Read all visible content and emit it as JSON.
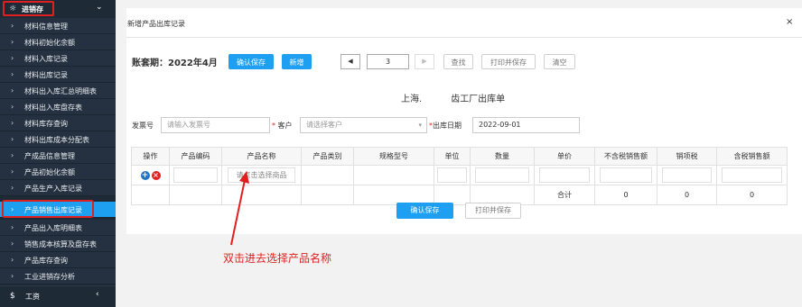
{
  "sidebar": {
    "section_icon": "☼",
    "section_label": "进销存",
    "section_chevron": "⌄",
    "items": [
      {
        "label": "材料信息管理"
      },
      {
        "label": "材料初始化余额"
      },
      {
        "label": "材料入库记录"
      },
      {
        "label": "材料出库记录"
      },
      {
        "label": "材料出入库汇总明细表"
      },
      {
        "label": "材料出入库盘存表"
      },
      {
        "label": "材料库存查询"
      },
      {
        "label": "材料出库成本分配表"
      },
      {
        "label": "产成品信息管理"
      },
      {
        "label": "产品初始化余额"
      },
      {
        "label": "产品生产入库记录"
      },
      {
        "label": "产品销售出库记录"
      },
      {
        "label": "产品出入库明细表"
      },
      {
        "label": "销售成本核算及盘存表"
      },
      {
        "label": "产品库存查询"
      },
      {
        "label": "工业进销存分析"
      }
    ],
    "footer_icon": "$",
    "footer_label": "工资",
    "footer_chevron": "‹",
    "item_arrow": "›",
    "active_color": "#1ea0f0",
    "highlight_color": "#e02020"
  },
  "modal": {
    "title": "新增产品出库记录",
    "close": "×",
    "period": "账套期：2022年4月",
    "buttons": {
      "confirm_save": "确认保存",
      "add_new": "新增",
      "find": "查找",
      "print_save": "打印并保存",
      "clear": "清空"
    },
    "pager": {
      "prev": "◀",
      "page": "3",
      "next": "▶"
    },
    "form_title_a": "上海.",
    "form_title_b": "齿工厂出库单",
    "fields": {
      "invoice_label": "发票号",
      "invoice_placeholder": "请输入发票号",
      "customer_label": "客户",
      "customer_placeholder": "请选择客户",
      "customer_dd": "▾",
      "date_label": "出库日期",
      "date_value": "2022-09-01",
      "required_mark": "*"
    },
    "table": {
      "headers": [
        "操作",
        "产品编码",
        "产品名称",
        "产品类别",
        "规格型号",
        "单位",
        "数量",
        "单价",
        "不含税销售额",
        "销项税",
        "含税销售额"
      ],
      "row1": {
        "add": "+",
        "del": "×",
        "product_placeholder": "请点击选择商品"
      },
      "total_row": {
        "label": "合计",
        "net": "0",
        "tax": "0",
        "gross": "0"
      }
    },
    "bottom_buttons": {
      "confirm_save": "确认保存",
      "print_save": "打印并保存"
    }
  },
  "annotation": "双击进去选择产品名称"
}
